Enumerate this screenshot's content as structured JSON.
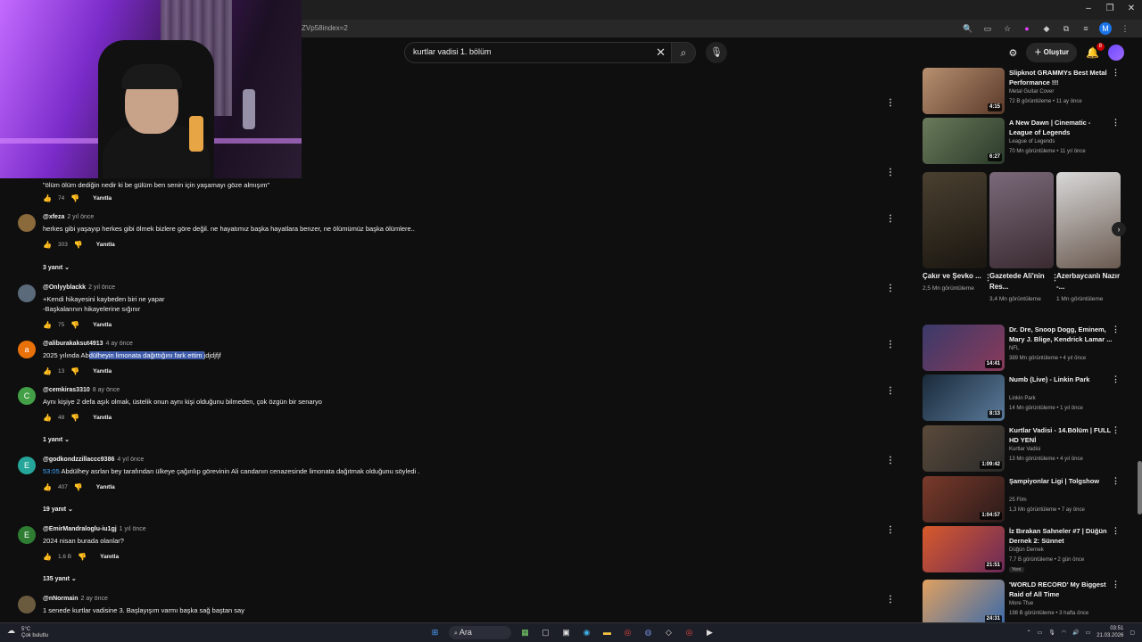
{
  "browser": {
    "url_fragment": "ZVp58index=2",
    "profile_letter": "M"
  },
  "header": {
    "search_value": "kurtlar vadisi 1. bölüm",
    "create_label": "Oluştur",
    "notifications_count": "8"
  },
  "comments": [
    {
      "author": "",
      "time": "",
      "text": "\"ölüm ölüm dediğin nedir ki be gülüm ben senin için yaşamayı göze almışım\"",
      "likes": "74",
      "reply_label": "Yanıtla"
    },
    {
      "author": "@xfeza",
      "time": "2 yıl önce",
      "text": "herkes gibi yaşayıp herkes gibi ölmek bizlere göre değil. ne hayatımız başka hayatlara benzer, ne ölümümüz başka ölümlere..",
      "likes": "303",
      "reply_label": "Yanıtla",
      "replies": "3 yanıt"
    },
    {
      "author": "@Onlyyblackk",
      "time": "2 yıl önce",
      "text": "+Kendi hikayesini kaybeden biri ne yapar",
      "text2": "-Başkalarının hikayelerine sığınır",
      "likes": "75",
      "reply_label": "Yanıtla"
    },
    {
      "author": "@aliburakaksut4913",
      "time": "4 ay önce",
      "text_pre": "2025 yılında Ab",
      "text_hl": "dülheyin limonata dağıttığını fark ettim ",
      "text_post": "jdjdjfjf",
      "likes": "13",
      "reply_label": "Yanıtla",
      "avatar_letter": "a"
    },
    {
      "author": "@cemkiras3310",
      "time": "8 ay önce",
      "text": "Aynı kişiye 2 defa aşık olmak, üstelik onun aynı kişi olduğunu bilmeden, çok özgün bir senaryo",
      "likes": "48",
      "reply_label": "Yanıtla",
      "replies": "1 yanıt",
      "avatar_letter": "C"
    },
    {
      "author": "@godkondzzillaccc9386",
      "time": "4 yıl önce",
      "timestamp_link": "53:05",
      "text": " Abdülhey asrlan bey tarafından ülkeye çağırılıp görevinin Ali candanın cenazesinde limonata dağıtmak olduğunu söyledi .",
      "likes": "407",
      "reply_label": "Yanıtla",
      "replies": "19 yanıt",
      "avatar_letter": "E"
    },
    {
      "author": "@EmirMandraloglu-iu1gj",
      "time": "1 yıl önce",
      "text": "2024 nisan burada olanlar?",
      "likes": "1,6 B",
      "reply_label": "Yanıtla",
      "replies": "135 yanıt",
      "avatar_letter": "E"
    },
    {
      "author": "@nNormain",
      "time": "2 ay önce",
      "text": "1 senede kurtlar vadisine  3. Başlayışım varmı başka sağ baştan say"
    }
  ],
  "sidebar": {
    "videos_top": [
      {
        "title": "Slipknot GRAMMYs Best Metal Performance !!!",
        "channel": "Metal Guitar Cover",
        "meta": "72 B görüntüleme • 11 ay önce",
        "duration": "4:15"
      },
      {
        "title": "A New Dawn | Cinematic - League of Legends",
        "channel": "League of Legends",
        "meta": "70 Mn görüntüleme • 11 yıl önce",
        "duration": "6:27"
      }
    ],
    "shorts": [
      {
        "title": "Çakır ve Şevko ...",
        "meta": "2,5 Mn görüntüleme"
      },
      {
        "title": "Gazetede Ali'nin Res...",
        "meta": "3,4 Mn görüntüleme"
      },
      {
        "title": "Azerbaycanlı Nazır -...",
        "meta": "1 Mn görüntüleme"
      }
    ],
    "videos_bottom": [
      {
        "title": "Dr. Dre, Snoop Dogg, Eminem, Mary J. Blige, Kendrick Lamar ...",
        "channel": "NFL",
        "meta": "389 Mn görüntüleme • 4 yıl önce",
        "duration": "14:41"
      },
      {
        "title": "Numb (Live) - Linkin Park",
        "channel": "Linkin Park",
        "meta": "14 Mn görüntüleme • 1 yıl önce",
        "duration": "8:13"
      },
      {
        "title": "Kurtlar Vadisi - 14.Bölüm | FULL HD YENİ",
        "channel": "Kurtlar Vadisi",
        "meta": "13 Mn görüntüleme • 4 yıl önce",
        "duration": "1:09:42"
      },
      {
        "title": "Şampiyonlar Ligi | Tolgshow",
        "channel": "25 Film",
        "meta": "1,3 Mn görüntüleme • 7 ay önce",
        "duration": "1:04:57"
      },
      {
        "title": "İz Bırakan Sahneler #7 | Düğün Dernek 2: Sünnet",
        "channel": "Düğün Dernek",
        "meta": "7,7 B görüntüleme • 2 gün önce",
        "duration": "21:51",
        "badge": "Yeni"
      },
      {
        "title": "'WORLD RECORD' My Biggest Raid of All Time",
        "channel": "More Tfue",
        "meta": "198 B görüntüleme • 3 hafta önce",
        "duration": "24:31"
      }
    ]
  },
  "taskbar": {
    "weather_temp": "5°C",
    "weather_desc": "Çok bulutlu",
    "search_label": "Ara",
    "time": "03:51",
    "date": "21.03.2026"
  },
  "colors": {
    "background": "#0f0f0f",
    "link_blue": "#3ea6ff",
    "selection": "#3c5aa8"
  }
}
